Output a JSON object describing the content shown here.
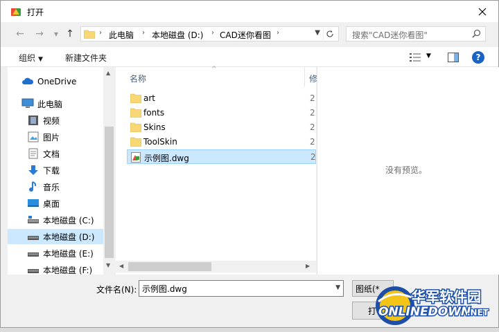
{
  "window": {
    "title": "打开"
  },
  "address": {
    "crumbs": [
      "此电脑",
      "本地磁盘 (D:)",
      "CAD迷你看图"
    ],
    "search_placeholder": "搜索\"CAD迷你看图\""
  },
  "toolbar": {
    "organize": "组织",
    "new_folder": "新建文件夹"
  },
  "nav": {
    "items": [
      {
        "label": "OneDrive",
        "icon": "cloud-icon"
      },
      {
        "label": "此电脑",
        "icon": "computer-icon"
      },
      {
        "label": "视频",
        "icon": "video-icon"
      },
      {
        "label": "图片",
        "icon": "picture-icon"
      },
      {
        "label": "文档",
        "icon": "document-icon"
      },
      {
        "label": "下载",
        "icon": "download-icon"
      },
      {
        "label": "音乐",
        "icon": "music-icon"
      },
      {
        "label": "桌面",
        "icon": "desktop-icon"
      },
      {
        "label": "本地磁盘 (C:)",
        "icon": "drive-icon"
      },
      {
        "label": "本地磁盘 (D:)",
        "icon": "drive-icon",
        "selected": true
      },
      {
        "label": "本地磁盘 (E:)",
        "icon": "drive-icon"
      },
      {
        "label": "本地磁盘 (F:)",
        "icon": "drive-icon"
      }
    ]
  },
  "columns": {
    "name": "名称",
    "date": "修"
  },
  "files": [
    {
      "name": "art",
      "type": "folder",
      "date": "2"
    },
    {
      "name": "fonts",
      "type": "folder",
      "date": "2"
    },
    {
      "name": "Skins",
      "type": "folder",
      "date": "2"
    },
    {
      "name": "ToolSkin",
      "type": "folder",
      "date": "2"
    },
    {
      "name": "示例图.dwg",
      "type": "dwg",
      "date": "2",
      "selected": true
    }
  ],
  "preview": {
    "text": "没有预览。"
  },
  "bottom": {
    "filename_label": "文件名(N):",
    "filename_value": "示例图.dwg",
    "filter": "图纸(*",
    "open": "打开"
  },
  "watermark": {
    "cn": "华军软件园",
    "en": "ONLINEDOWN",
    "suffix": ".NET"
  },
  "colors": {
    "selection": "#cce8ff",
    "accent": "#1b62c7",
    "folder": "#f8d775"
  }
}
